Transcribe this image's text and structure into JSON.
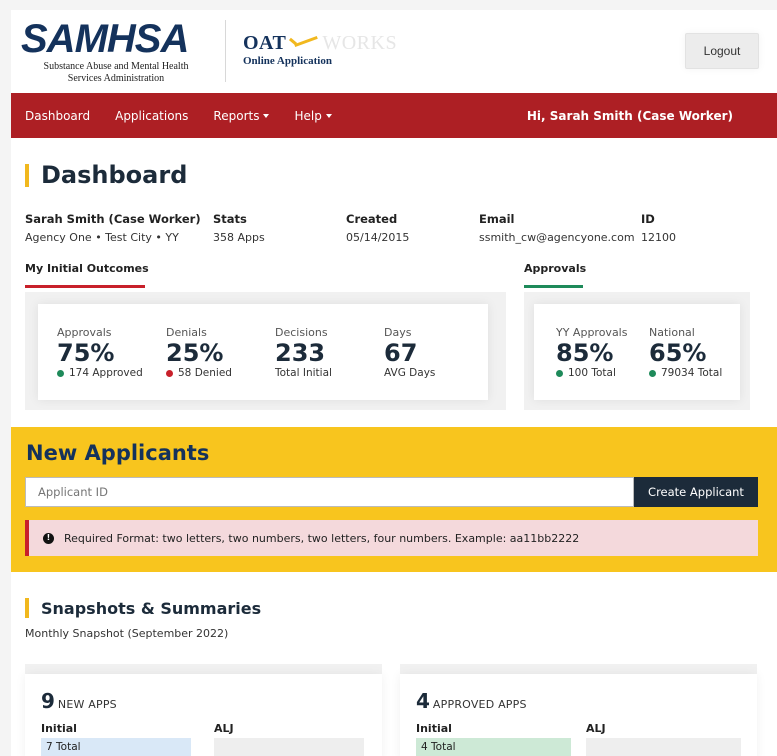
{
  "header": {
    "logo_word": "SAMHSA",
    "logo_sub_line1": "Substance Abuse and Mental Health",
    "logo_sub_line2": "Services Administration",
    "oat_prefix": "OAT",
    "oat_suffix": "WORKS",
    "oat_sub": "Online Application",
    "logout_label": "Logout"
  },
  "nav": {
    "items": [
      {
        "label": "Dashboard",
        "dropdown": false
      },
      {
        "label": "Applications",
        "dropdown": false
      },
      {
        "label": "Reports",
        "dropdown": true
      },
      {
        "label": "Help",
        "dropdown": true
      }
    ],
    "greeting": "Hi, Sarah Smith (Case Worker)"
  },
  "dashboard": {
    "title": "Dashboard",
    "info": [
      {
        "label": "Sarah Smith (Case Worker)",
        "value": "Agency One • Test City • YY"
      },
      {
        "label": "Stats",
        "value": "358 Apps"
      },
      {
        "label": "Created",
        "value": "05/14/2015"
      },
      {
        "label": "Email",
        "value": "ssmith_cw@agencyone.com"
      },
      {
        "label": "ID",
        "value": "12100"
      }
    ],
    "outcomes_label": "My Initial Outcomes",
    "approvals_label": "Approvals",
    "outcomes": [
      {
        "label": "Approvals",
        "value": "75%",
        "sub": "174 Approved",
        "dot": "green"
      },
      {
        "label": "Denials",
        "value": "25%",
        "sub": "58 Denied",
        "dot": "red"
      },
      {
        "label": "Decisions",
        "value": "233",
        "sub": "Total Initial",
        "dot": ""
      },
      {
        "label": "Days",
        "value": "67",
        "sub": "AVG Days",
        "dot": ""
      }
    ],
    "approvals": [
      {
        "label": "YY Approvals",
        "value": "85%",
        "sub": "100 Total",
        "dot": "green"
      },
      {
        "label": "National",
        "value": "65%",
        "sub": "79034 Total",
        "dot": "green"
      }
    ]
  },
  "applicants": {
    "title": "New Applicants",
    "input_placeholder": "Applicant ID",
    "create_label": "Create Applicant",
    "alert_icon": "!",
    "alert_text": "Required Format: two letters, two numbers, two letters, four numbers. Example: aa11bb2222"
  },
  "snapshots": {
    "title": "Snapshots & Summaries",
    "subtitle": "Monthly Snapshot (September 2022)",
    "cards": [
      {
        "number": "9",
        "number_label": "NEW APPS",
        "initial_label": "Initial",
        "alj_label": "ALJ",
        "initial_value": "7 Total",
        "initial_color": "#d9e8f7"
      },
      {
        "number": "4",
        "number_label": "APPROVED APPS",
        "initial_label": "Initial",
        "alj_label": "ALJ",
        "initial_value": "4 Total",
        "initial_color": "#cde9d6"
      }
    ]
  },
  "colors": {
    "brand_navy": "#14325c",
    "nav_red": "#ad1f24",
    "accent_yellow": "#f1b81e",
    "applicants_yellow": "#f8c51e",
    "approvals_green": "#1e8a5a"
  }
}
